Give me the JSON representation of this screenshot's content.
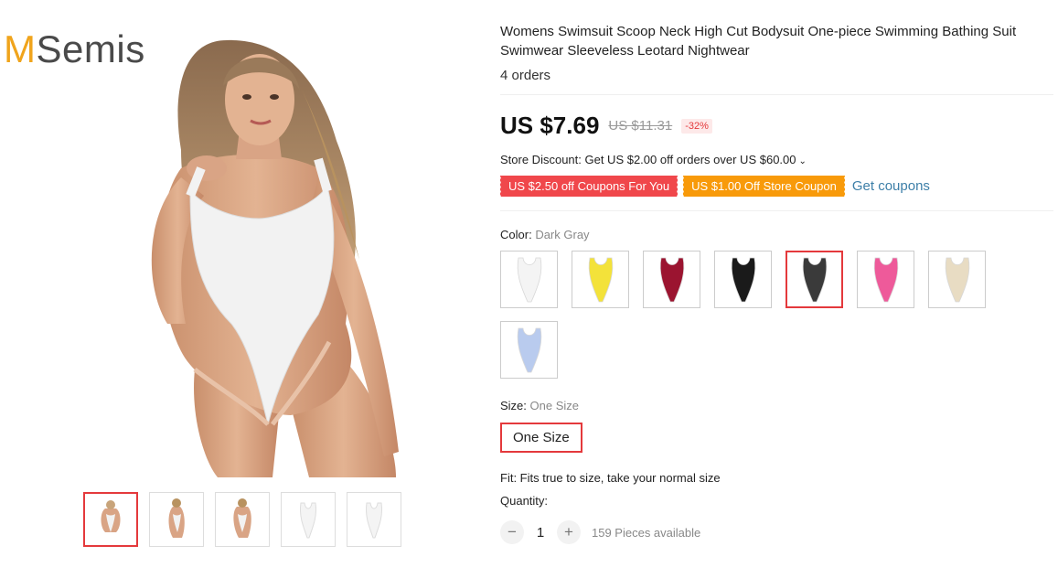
{
  "brand": {
    "logo_m": "M",
    "logo_rest": "Semis"
  },
  "product": {
    "title": "Womens Swimsuit Scoop Neck High Cut Bodysuit One-piece Swimming Bathing Suit Swimwear Sleeveless Leotard Nightwear",
    "orders": "4 orders"
  },
  "price": {
    "current": "US $7.69",
    "original": "US $11.31",
    "discount": "-32%"
  },
  "promotions": {
    "store_discount": "Store Discount: Get US $2.00 off orders over US $60.00",
    "chevron": "⌄",
    "coupon_1": "US $2.50 off Coupons For You",
    "coupon_2": "US $1.00 Off Store Coupon",
    "get_coupons": "Get coupons"
  },
  "color": {
    "label": "Color:",
    "selected": "Dark Gray",
    "options": [
      {
        "name": "White",
        "hex": "#f4f4f4"
      },
      {
        "name": "Yellow",
        "hex": "#f3e23a"
      },
      {
        "name": "Wine Red",
        "hex": "#9b1430"
      },
      {
        "name": "Black",
        "hex": "#1a1a1a"
      },
      {
        "name": "Dark Gray",
        "hex": "#3a3a3a"
      },
      {
        "name": "Pink",
        "hex": "#ee5a9a"
      },
      {
        "name": "Beige",
        "hex": "#e8dcc3"
      },
      {
        "name": "Light Blue",
        "hex": "#b9cbee"
      }
    ]
  },
  "size": {
    "label": "Size:",
    "selected": "One Size",
    "option": "One Size"
  },
  "fit": "Fit: Fits true to size, take your normal size",
  "quantity": {
    "label": "Quantity:",
    "minus": "−",
    "value": "1",
    "plus": "+",
    "available": "159 Pieces available"
  },
  "gallery": {
    "thumb_count": 5,
    "active_index": 0
  },
  "colors": {
    "accent": "#e4393c",
    "coupon_red": "#f0474b",
    "coupon_orange": "#f89a0a",
    "link": "#3d7fa8"
  }
}
